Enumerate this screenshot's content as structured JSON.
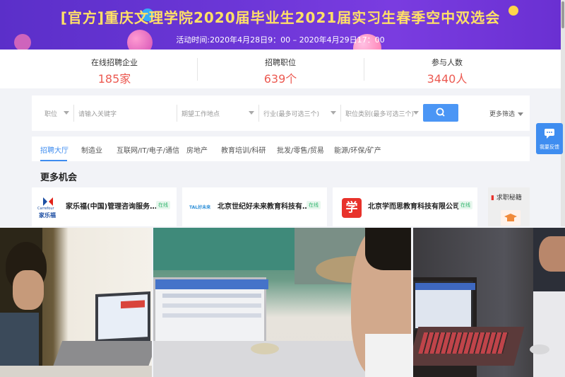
{
  "banner": {
    "title": "[官方]重庆文理学院2020届毕业生2021届实习生春季空中双选会",
    "subtitle": "活动时间:2020年4月28日9：00 – 2020年4月29日17：00"
  },
  "stats": [
    {
      "label": "在线招聘企业",
      "value": "185家"
    },
    {
      "label": "招聘职位",
      "value": "639个"
    },
    {
      "label": "参与人数",
      "value": "3440人"
    }
  ],
  "search": {
    "position_select": "职位",
    "keyword_placeholder": "请输入关键字",
    "location_select": "期望工作地点",
    "industry_select": "行业(最多可选三个)",
    "category_select": "职位类别(最多可选三个)",
    "more_filter": "更多筛选"
  },
  "feedback": {
    "label": "我要反馈"
  },
  "tabs": [
    "招聘大厅",
    "制造业",
    "互联网/IT/电子/通信",
    "房地产",
    "教育培训/科研",
    "批发/零售/贸易",
    "能源/环保/矿产"
  ],
  "section_title": "更多机会",
  "companies": [
    {
      "name": "家乐福(中国)管理咨询服务…",
      "status": "在线",
      "logo_text": "Carrefour",
      "logo_sub": "家乐福"
    },
    {
      "name": "北京世纪好未来教育科技有…",
      "status": "在线",
      "logo_text": "TAL好未来"
    },
    {
      "name": "北京学而思教育科技有限公司",
      "status": "在线",
      "logo_text": "学"
    }
  ],
  "job_tips": {
    "label": "求职秘籍"
  },
  "colors": {
    "accent": "#3f8df0",
    "stat_value": "#ec5a52",
    "banner_title": "#ffe066",
    "online_badge": "#2db36a"
  }
}
